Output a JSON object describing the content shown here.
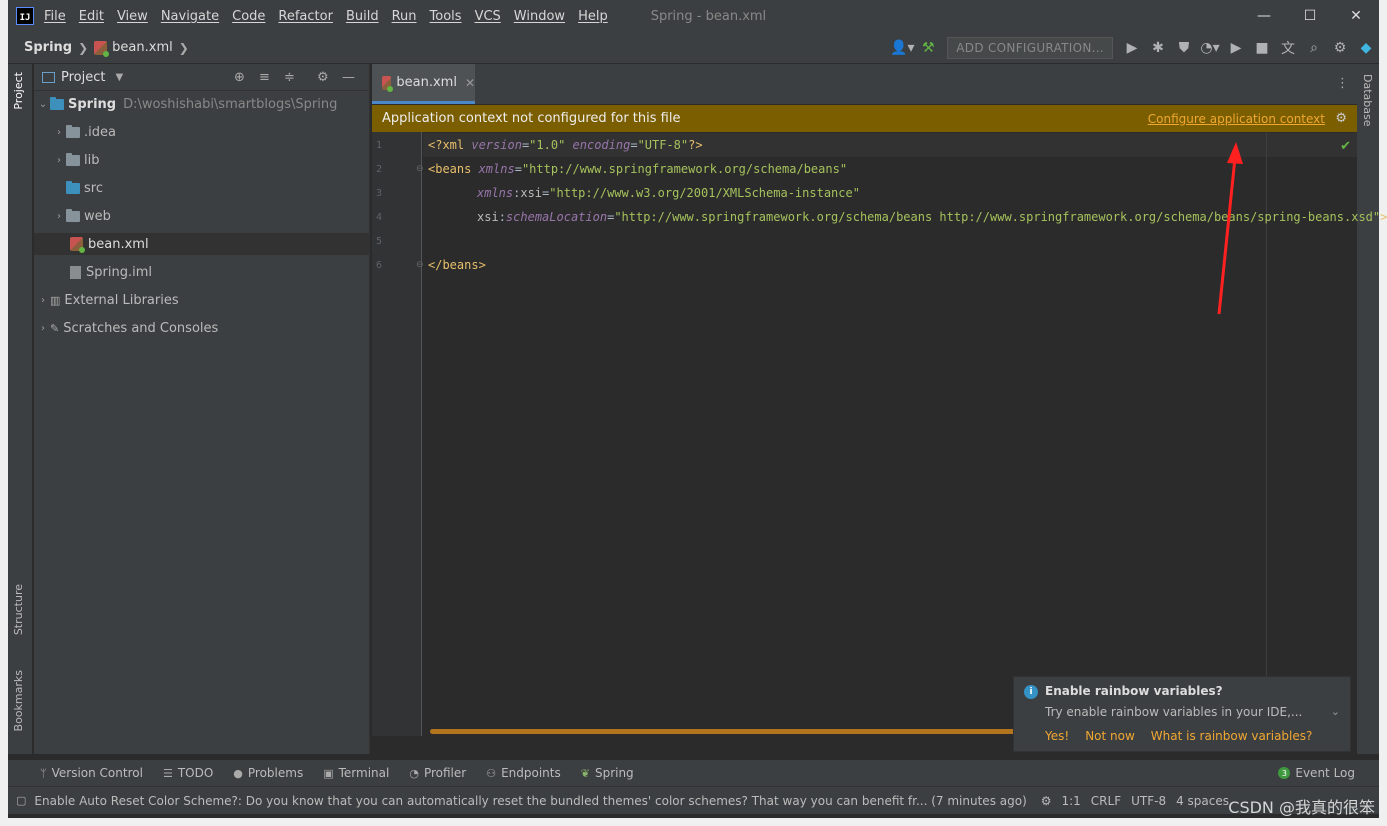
{
  "menu": {
    "items": [
      "File",
      "Edit",
      "View",
      "Navigate",
      "Code",
      "Refactor",
      "Build",
      "Run",
      "Tools",
      "VCS",
      "Window",
      "Help"
    ],
    "window_title": "Spring - bean.xml",
    "minimize": "—",
    "maximize": "☐",
    "close": "✕"
  },
  "navbar": {
    "project": "Spring",
    "file": "bean.xml",
    "add_configuration": "ADD CONFIGURATION..."
  },
  "side_tabs": {
    "project": "Project",
    "structure": "Structure",
    "bookmarks": "Bookmarks",
    "database": "Database"
  },
  "project_panel": {
    "title": "Project",
    "tree": [
      {
        "label": "Spring",
        "path": "D:\\woshishabi\\smartblogs\\Spring"
      },
      {
        "label": ".idea"
      },
      {
        "label": "lib"
      },
      {
        "label": "src"
      },
      {
        "label": "web"
      },
      {
        "label": "bean.xml"
      },
      {
        "label": "Spring.iml"
      },
      {
        "label": "External Libraries"
      },
      {
        "label": "Scratches and Consoles"
      }
    ]
  },
  "editor": {
    "tab": "bean.xml",
    "banner_text": "Application context not configured for this file",
    "banner_link": "Configure application context",
    "line_numbers": [
      "1",
      "2",
      "3",
      "4",
      "5",
      "6"
    ],
    "lines": {
      "l1_decl_open": "<?xml ",
      "l1_attr1": "version",
      "l1_val1": "\"1.0\"",
      "l1_attr2": "encoding",
      "l1_val2": "\"UTF-8\"",
      "l1_close": "?>",
      "l2_tag": "<beans ",
      "l2_attr": "xmlns",
      "l2_val": "\"http://www.springframework.org/schema/beans\"",
      "l3_ns": "xmlns",
      "l3_attr": "xsi",
      "l3_val": "\"http://www.w3.org/2001/XMLSchema-instance\"",
      "l4_ns": "xsi",
      "l4_attr": "schemaLocation",
      "l4_val": "\"http://www.springframework.org/schema/beans http://www.springframework.org/schema/beans/spring-beans.xsd\"",
      "l4_close": ">",
      "l6_tag": "</beans>"
    }
  },
  "notification": {
    "title": "Enable rainbow variables?",
    "body": "Try enable rainbow variables in your IDE,...",
    "actions": [
      "Yes!",
      "Not now",
      "What is rainbow variables?"
    ]
  },
  "bottom_tools": [
    "Version Control",
    "TODO",
    "Problems",
    "Terminal",
    "Profiler",
    "Endpoints",
    "Spring"
  ],
  "event_log": {
    "count": "3",
    "label": "Event Log"
  },
  "status": {
    "message": "Enable Auto Reset Color Scheme?: Do you know that you can automatically reset the bundled themes' color schemes? That way you can benefit fr... (7 minutes ago)",
    "position": "1:1",
    "line_sep": "CRLF",
    "encoding": "UTF-8",
    "indent": "4 spaces"
  },
  "watermark": "CSDN @我真的很笨",
  "colors": {
    "accent": "#4a88c7",
    "banner": "#7a5e00",
    "link": "#f0a732",
    "annotation_arrow": "#ff2020"
  }
}
